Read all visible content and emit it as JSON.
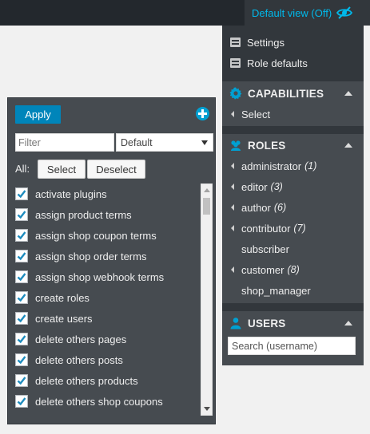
{
  "topbar": {
    "view_toggle_label": "Default view (Off)",
    "view_toggle_icon": "eye-slash-icon",
    "accent": "#00b9eb"
  },
  "menu": {
    "settings_label": "Settings",
    "role_defaults_label": "Role defaults"
  },
  "capabilities_section": {
    "title": "CAPABILITIES",
    "select_label": "Select"
  },
  "roles_section": {
    "title": "ROLES",
    "roles": [
      {
        "name": "administrator",
        "count": "(1)",
        "has_arrow": true
      },
      {
        "name": "editor",
        "count": "(3)",
        "has_arrow": true
      },
      {
        "name": "author",
        "count": "(6)",
        "has_arrow": true
      },
      {
        "name": "contributor",
        "count": "(7)",
        "has_arrow": true
      },
      {
        "name": "subscriber",
        "count": "",
        "has_arrow": false
      },
      {
        "name": "customer",
        "count": "(8)",
        "has_arrow": true
      },
      {
        "name": "shop_manager",
        "count": "",
        "has_arrow": false
      }
    ]
  },
  "users_section": {
    "title": "USERS",
    "search_placeholder": "Search (username)"
  },
  "cap_panel": {
    "apply_label": "Apply",
    "filter_placeholder": "Filter",
    "view_select_value": "Default",
    "all_label": "All:",
    "select_label": "Select",
    "deselect_label": "Deselect",
    "capabilities": [
      "activate plugins",
      "assign product terms",
      "assign shop coupon terms",
      "assign shop order terms",
      "assign shop webhook terms",
      "create roles",
      "create users",
      "delete others pages",
      "delete others posts",
      "delete others products",
      "delete others shop coupons"
    ]
  }
}
